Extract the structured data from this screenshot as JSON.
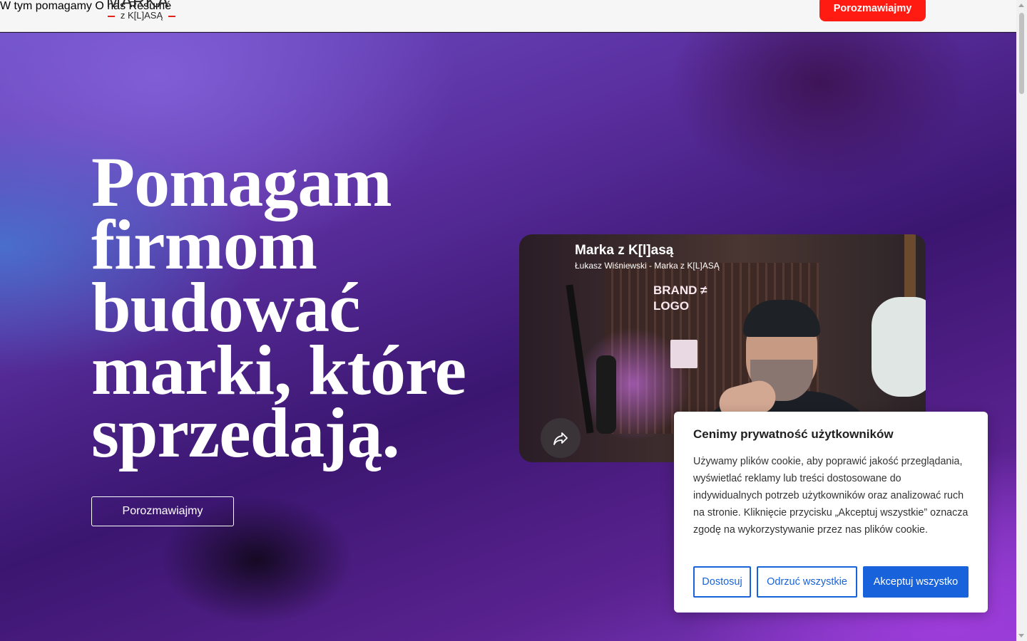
{
  "header": {
    "logo": {
      "big": "MARKA",
      "small": "z K[L]ASĄ"
    },
    "nav": [
      {
        "label": "W tym pomagamy"
      },
      {
        "label": "O nas"
      },
      {
        "label": "Résumé"
      }
    ],
    "cta_label": "Porozmawiajmy"
  },
  "hero": {
    "headline_lines": [
      "Pomagam",
      "firmom",
      "budować",
      "marki, które",
      "sprzedają."
    ],
    "button_label": "Porozmawiajmy"
  },
  "video": {
    "title": "Marka z K[l]asą",
    "channel": "Łukasz Wiśniewski - Marka z K[L]ASĄ",
    "sign_line1": "BRAND ≠",
    "sign_line2": "LOGO",
    "share_icon": "share-icon"
  },
  "cookie": {
    "title": "Cenimy prywatność użytkowników",
    "text": "Używamy plików cookie, aby poprawić jakość przeglądania, wyświetlać reklamy lub treści dostosowane do indywidualnych potrzeb użytkowników oraz analizować ruch na stronie. Kliknięcie przycisku „Akceptuj wszystkie” oznacza zgodę na wykorzystywanie przez nas plików cookie.",
    "customize_label": "Dostosuj",
    "reject_label": "Odrzuć wszystkie",
    "accept_label": "Akceptuj wszystko"
  },
  "colors": {
    "cta_red": "#ff1a12",
    "cookie_blue": "#1863dc"
  }
}
